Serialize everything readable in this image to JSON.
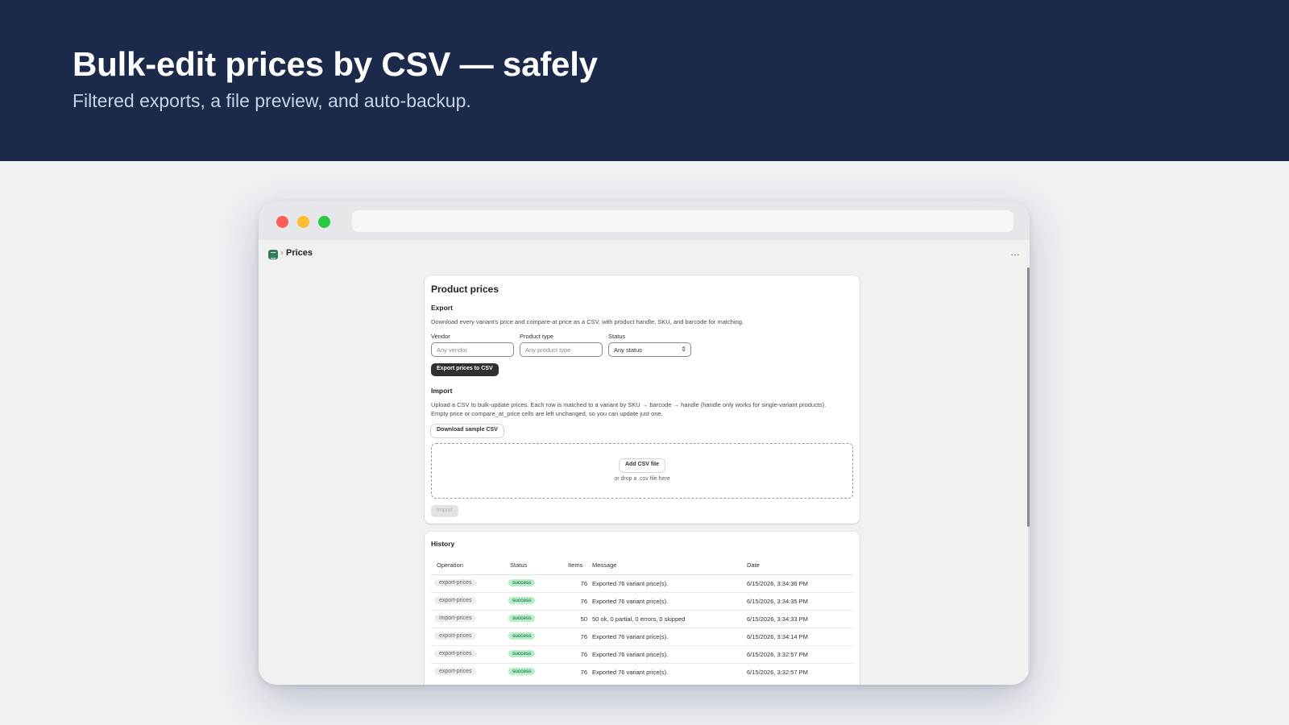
{
  "banner": {
    "title": "Bulk-edit prices by CSV — safely",
    "subtitle": "Filtered exports, a file preview, and auto-backup."
  },
  "app": {
    "breadcrumb_separator": "›",
    "page_title": "Prices",
    "more_icon": "…"
  },
  "product_prices": {
    "title": "Product prices",
    "export": {
      "heading": "Export",
      "description": "Download every variant's price and compare-at price as a CSV, with product handle, SKU, and barcode for matching.",
      "vendor_label": "Vendor",
      "vendor_placeholder": "Any vendor",
      "product_type_label": "Product type",
      "product_type_placeholder": "Any product type",
      "status_label": "Status",
      "status_value": "Any status",
      "export_button": "Export prices to CSV"
    },
    "import": {
      "heading": "Import",
      "description_line1": "Upload a CSV to bulk-update prices. Each row is matched to a variant by SKU → barcode → handle (handle only works for single-variant products).",
      "description_line2": "Empty price or compare_at_price cells are left unchanged, so you can update just one.",
      "sample_button": "Download sample CSV",
      "add_file_button": "Add CSV file",
      "drop_hint": "or drop a .csv file here",
      "import_button": "Import"
    }
  },
  "history": {
    "title": "History",
    "columns": [
      "Operation",
      "Status",
      "Items",
      "Message",
      "Date"
    ],
    "rows": [
      {
        "operation": "export-prices",
        "status": "success",
        "items": "76",
        "message": "Exported 76 variant price(s).",
        "date": "6/15/2026, 3:34:36 PM"
      },
      {
        "operation": "export-prices",
        "status": "success",
        "items": "76",
        "message": "Exported 76 variant price(s).",
        "date": "6/15/2026, 3:34:35 PM"
      },
      {
        "operation": "import-prices",
        "status": "success",
        "items": "50",
        "message": "50 ok, 0 partial, 0 errors, 0 skipped",
        "date": "6/15/2026, 3:34:33 PM"
      },
      {
        "operation": "export-prices",
        "status": "success",
        "items": "76",
        "message": "Exported 76 variant price(s).",
        "date": "6/15/2026, 3:34:14 PM"
      },
      {
        "operation": "export-prices",
        "status": "success",
        "items": "76",
        "message": "Exported 76 variant price(s).",
        "date": "6/15/2026, 3:32:57 PM"
      },
      {
        "operation": "export-prices",
        "status": "success",
        "items": "76",
        "message": "Exported 76 variant price(s).",
        "date": "6/15/2026, 3:32:57 PM"
      }
    ]
  },
  "colors": {
    "banner_bg": "#1b2a4a",
    "success_badge": "#b5f0c8",
    "primary_button": "#303030"
  }
}
